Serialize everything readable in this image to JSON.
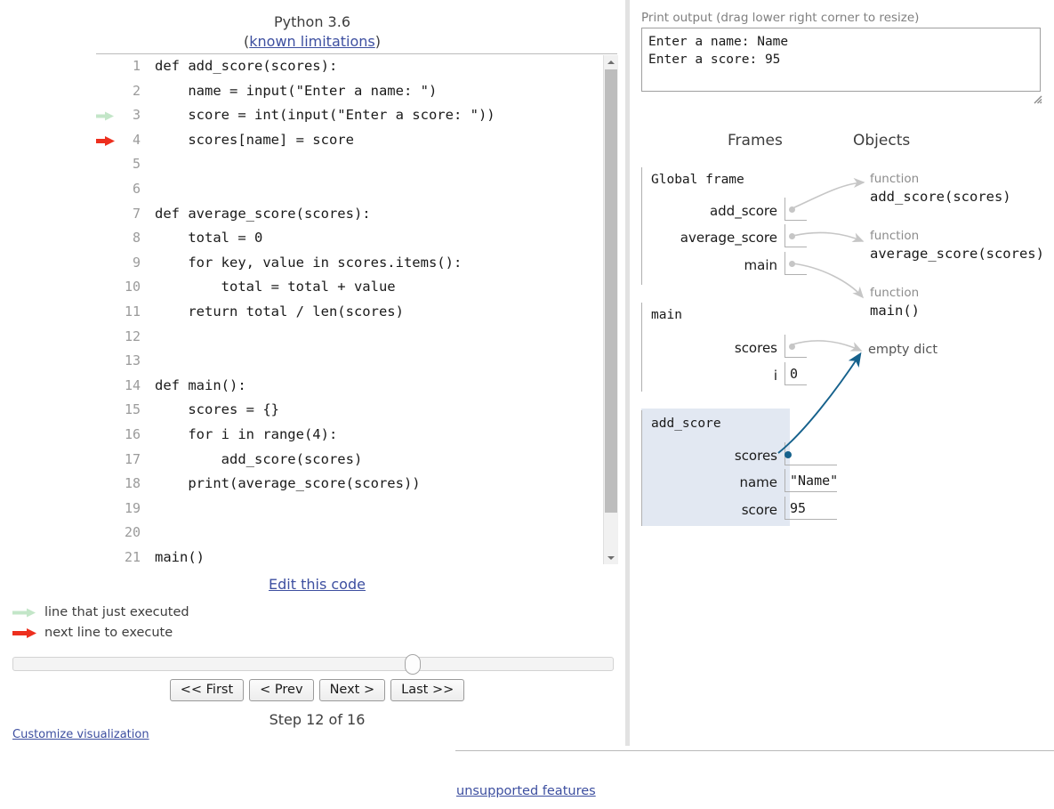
{
  "language": {
    "title": "Python 3.6",
    "limitations_label": "known limitations",
    "paren_open": "(",
    "paren_close": ")"
  },
  "code": {
    "lines": [
      {
        "num": "1",
        "text": "def add_score(scores):",
        "marker": "none"
      },
      {
        "num": "2",
        "text": "    name = input(\"Enter a name: \")",
        "marker": "none"
      },
      {
        "num": "3",
        "text": "    score = int(input(\"Enter a score: \"))",
        "marker": "just-executed"
      },
      {
        "num": "4",
        "text": "    scores[name] = score",
        "marker": "next-to-execute"
      },
      {
        "num": "5",
        "text": "",
        "marker": "none"
      },
      {
        "num": "6",
        "text": "",
        "marker": "none"
      },
      {
        "num": "7",
        "text": "def average_score(scores):",
        "marker": "none"
      },
      {
        "num": "8",
        "text": "    total = 0",
        "marker": "none"
      },
      {
        "num": "9",
        "text": "    for key, value in scores.items():",
        "marker": "none"
      },
      {
        "num": "10",
        "text": "        total = total + value",
        "marker": "none"
      },
      {
        "num": "11",
        "text": "    return total / len(scores)",
        "marker": "none"
      },
      {
        "num": "12",
        "text": "",
        "marker": "none"
      },
      {
        "num": "13",
        "text": "",
        "marker": "none"
      },
      {
        "num": "14",
        "text": "def main():",
        "marker": "none"
      },
      {
        "num": "15",
        "text": "    scores = {}",
        "marker": "none"
      },
      {
        "num": "16",
        "text": "    for i in range(4):",
        "marker": "none"
      },
      {
        "num": "17",
        "text": "        add_score(scores)",
        "marker": "none"
      },
      {
        "num": "18",
        "text": "    print(average_score(scores))",
        "marker": "none"
      },
      {
        "num": "19",
        "text": "",
        "marker": "none"
      },
      {
        "num": "20",
        "text": "",
        "marker": "none"
      },
      {
        "num": "21",
        "text": "main()",
        "marker": "none"
      }
    ],
    "edit_link": "Edit this code"
  },
  "legend": {
    "just_executed": "line that just executed",
    "next_to_execute": "next line to execute"
  },
  "controls": {
    "first": "<< First",
    "prev": "< Prev",
    "next": "Next >",
    "last": "Last >>",
    "step_label": "Step 12 of 16",
    "customize": "Customize visualization"
  },
  "output": {
    "label": "Print output (drag lower right corner to resize)",
    "text": "Enter a name: Name\nEnter a score: 95"
  },
  "viz": {
    "frames_heading": "Frames",
    "objects_heading": "Objects",
    "frames": [
      {
        "title": "Global frame",
        "highlighted": false,
        "vars": [
          {
            "name": "add_score",
            "value": "",
            "is_pointer": true
          },
          {
            "name": "average_score",
            "value": "",
            "is_pointer": true
          },
          {
            "name": "main",
            "value": "",
            "is_pointer": true
          }
        ]
      },
      {
        "title": "main",
        "highlighted": false,
        "vars": [
          {
            "name": "scores",
            "value": "",
            "is_pointer": true
          },
          {
            "name": "i",
            "value": "0",
            "is_pointer": false
          }
        ]
      },
      {
        "title": "add_score",
        "highlighted": true,
        "vars": [
          {
            "name": "scores",
            "value": "",
            "is_pointer": true
          },
          {
            "name": "name",
            "value": "\"Name\"",
            "is_pointer": false
          },
          {
            "name": "score",
            "value": "95",
            "is_pointer": false
          }
        ]
      }
    ],
    "objects": [
      {
        "type": "function",
        "name": "add_score(scores)"
      },
      {
        "type": "function",
        "name": "average_score(scores)"
      },
      {
        "type": "function",
        "name": "main()"
      },
      {
        "type": "",
        "name": "empty dict"
      }
    ]
  },
  "footer": {
    "unsupported": "unsupported features"
  },
  "colors": {
    "link": "#3d4fa0",
    "just_executed_arrow": "#c3e6c8",
    "next_arrow": "#ed2f1e",
    "highlight_frame": "#e2e8f2",
    "active_pointer": "#15618c",
    "pointer": "#c6c6c6"
  }
}
